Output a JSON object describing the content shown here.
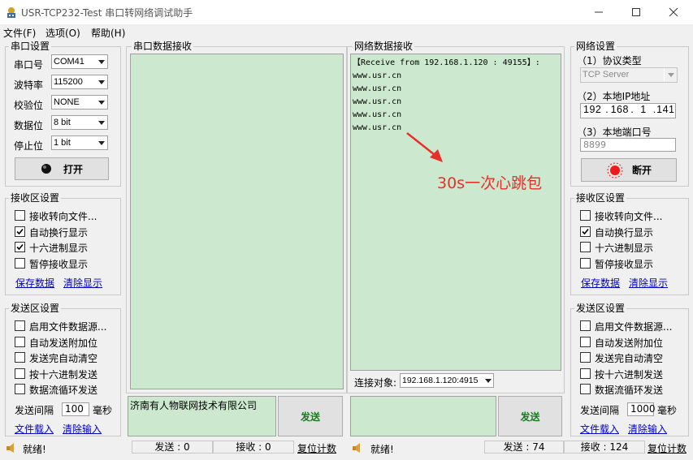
{
  "window": {
    "title": "USR-TCP232-Test 串口转网络调试助手"
  },
  "menu": [
    "文件(F)",
    "选项(O)",
    "帮助(H)"
  ],
  "serial_settings": {
    "title": "串口设置",
    "port_label": "串口号",
    "port_value": "COM41",
    "baud_label": "波特率",
    "baud_value": "115200",
    "parity_label": "校验位",
    "parity_value": "NONE",
    "databits_label": "数据位",
    "databits_value": "8 bit",
    "stopbits_label": "停止位",
    "stopbits_value": "1 bit",
    "open_button": "打开"
  },
  "left_receive": {
    "title": "接收区设置",
    "options": [
      {
        "label": "接收转向文件...",
        "checked": false
      },
      {
        "label": "自动换行显示",
        "checked": true
      },
      {
        "label": "十六进制显示",
        "checked": true
      },
      {
        "label": "暂停接收显示",
        "checked": false
      }
    ],
    "save_link": "保存数据",
    "clear_link": "清除显示"
  },
  "left_send": {
    "title": "发送区设置",
    "options": [
      {
        "label": "启用文件数据源...",
        "checked": false
      },
      {
        "label": "自动发送附加位",
        "checked": false
      },
      {
        "label": "发送完自动清空",
        "checked": false
      },
      {
        "label": "按十六进制发送",
        "checked": false
      },
      {
        "label": "数据流循环发送",
        "checked": false
      }
    ],
    "interval_label": "发送间隔",
    "interval_value": "100",
    "interval_unit": "毫秒",
    "load_link": "文件载入",
    "clear_link": "清除输入"
  },
  "serial_recv_panel": {
    "title": "串口数据接收"
  },
  "serial_send": {
    "text": "济南有人物联网技术有限公司",
    "button": "发送"
  },
  "net_recv_panel": {
    "title": "网络数据接收",
    "lines": [
      "【Receive from 192.168.1.120 : 49155】:",
      "www.usr.cn",
      "www.usr.cn",
      "www.usr.cn",
      "www.usr.cn",
      "www.usr.cn"
    ],
    "annotation": "30s一次心跳包",
    "annotation_color": "#e8302a"
  },
  "connect": {
    "label": "连接对象:",
    "value": "192.168.1.120:4915"
  },
  "net_send": {
    "text": "",
    "button": "发送"
  },
  "net_settings": {
    "title": "网络设置",
    "protocol_label": "（1）协议类型",
    "protocol_value": "TCP Server",
    "ip_label": "（2）本地IP地址",
    "ip_parts": [
      "192",
      "168",
      "1",
      "141"
    ],
    "port_label": "（3）本地端口号",
    "port_value": "8899",
    "disconnect_button": "断开"
  },
  "right_receive": {
    "title": "接收区设置",
    "options": [
      {
        "label": "接收转向文件...",
        "checked": false
      },
      {
        "label": "自动换行显示",
        "checked": true
      },
      {
        "label": "十六进制显示",
        "checked": false
      },
      {
        "label": "暂停接收显示",
        "checked": false
      }
    ],
    "save_link": "保存数据",
    "clear_link": "清除显示"
  },
  "right_send": {
    "title": "发送区设置",
    "options": [
      {
        "label": "启用文件数据源...",
        "checked": false
      },
      {
        "label": "自动发送附加位",
        "checked": false
      },
      {
        "label": "发送完自动清空",
        "checked": false
      },
      {
        "label": "按十六进制发送",
        "checked": false
      },
      {
        "label": "数据流循环发送",
        "checked": false
      }
    ],
    "interval_label": "发送间隔",
    "interval_value": "1000",
    "interval_unit": "毫秒",
    "load_link": "文件载入",
    "clear_link": "清除输入"
  },
  "status_left": {
    "ready": "就绪!",
    "send": "发送 : 0",
    "recv": "接收 : 0",
    "reset": "复位计数"
  },
  "status_right": {
    "ready": "就绪!",
    "send": "发送 : 74",
    "recv": "接收 : 124",
    "reset": "复位计数"
  }
}
